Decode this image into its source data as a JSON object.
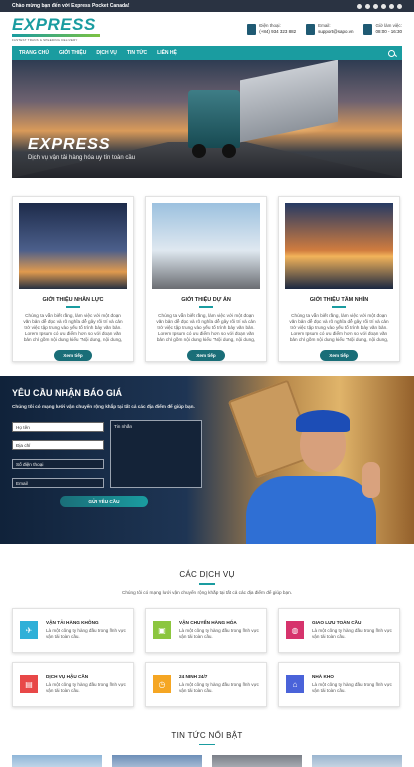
{
  "topbar": {
    "welcome": "Chào mừng bạn đến với Express Pocket Canada!"
  },
  "header": {
    "logo": "EXPRESS",
    "logo_tagline": "FASTEST TRANS & SPEEDING DELIVERY",
    "phone_label": "Điện thoại:",
    "phone_value": "(+84) 934 323 882",
    "email_label": "Email:",
    "email_value": "support@sapo.vn",
    "hours_label": "Giờ làm việc:",
    "hours_value": "08:00 - 16:30"
  },
  "nav": {
    "items": [
      {
        "label": "TRANG CHỦ"
      },
      {
        "label": "GIỚI THIỆU"
      },
      {
        "label": "DỊCH VỤ"
      },
      {
        "label": "TIN TỨC"
      },
      {
        "label": "LIÊN HỆ"
      }
    ]
  },
  "hero": {
    "title": "EXPRESS",
    "subtitle": "Dịch vụ vận tải hàng hóa uy tín toàn cầu"
  },
  "cards": [
    {
      "title": "GIỚI THIỆU NHÂN LỰC",
      "text": "Chúng ta vẫn biết rằng, làm việc với một đoạn văn bản dễ đọc và rõ nghĩa dễ gây rối trí và cản trở việc tập trung vào yếu tố trình bày văn bản. Lorem Ipsum có ưu điểm hơn so với đoạn văn bản chỉ gồm nội dung kiểu \"Nội dung, nội dung, nội dung\"",
      "button": "Xem tiếp"
    },
    {
      "title": "GIỚI THIỆU DỰ ÁN",
      "text": "Chúng ta vẫn biết rằng, làm việc với một đoạn văn bản dễ đọc và rõ nghĩa dễ gây rối trí và cản trở việc tập trung vào yếu tố trình bày văn bản. Lorem Ipsum có ưu điểm hơn so với đoạn văn bản chỉ gồm nội dung kiểu \"Nội dung, nội dung, nội dung\"",
      "button": "Xem tiếp"
    },
    {
      "title": "GIỚI THIỆU TẦM NHÌN",
      "text": "Chúng ta vẫn biết rằng, làm việc với một đoạn văn bản dễ đọc và rõ nghĩa dễ gây rối trí và cản trở việc tập trung vào yếu tố trình bày văn bản. Lorem Ipsum có ưu điểm hơn so với đoạn văn bản chỉ gồm nội dung kiểu \"Nội dung, nội dung, nội dung\"",
      "button": "Xem tiếp"
    }
  ],
  "quote": {
    "title": "YÊU CẦU NHẬN BÁO GIÁ",
    "subtitle": "Chúng tôi có mạng lưới vận chuyển rộng khắp tại tất cả các địa điểm để giúp bạn.",
    "name_placeholder": "Họ tên",
    "address_placeholder": "Địa chỉ",
    "phone_placeholder": "Số điện thoại",
    "email_placeholder": "Email",
    "message_placeholder": "Tin nhắn",
    "submit": "GỬI YÊU CẦU"
  },
  "services": {
    "title": "CÁC DỊCH VỤ",
    "subtitle": "Chúng tôi có mạng lưới vận chuyển rộng khắp tại tất cả các địa điểm để giúp bạn.",
    "items": [
      {
        "title": "VẬN TẢI HÀNG KHÔNG",
        "desc": "Là một công ty hàng đầu trong lĩnh vực vận tải toàn cầu.",
        "color": "#2fb0d8",
        "icon": "plane-icon"
      },
      {
        "title": "VẬN CHUYỂN HÀNG HÓA",
        "desc": "Là một công ty hàng đầu trong lĩnh vực vận tải toàn cầu.",
        "color": "#8cc63f",
        "icon": "package-icon"
      },
      {
        "title": "GIAO LƯU TOÀN CẦU",
        "desc": "Là một công ty hàng đầu trong lĩnh vực vận tải toàn cầu.",
        "color": "#d6336c",
        "icon": "globe-icon"
      },
      {
        "title": "DỊCH VỤ HẬU CẦN",
        "desc": "Là một công ty hàng đầu trong lĩnh vực vận tải toàn cầu.",
        "color": "#e84848",
        "icon": "truck-icon"
      },
      {
        "title": "24 NINH 24/7",
        "desc": "Là một công ty hàng đầu trong lĩnh vực vận tải toàn cầu.",
        "color": "#f5a623",
        "icon": "clock-icon"
      },
      {
        "title": "NHÀ KHO",
        "desc": "Là một công ty hàng đầu trong lĩnh vực vận tải toàn cầu.",
        "color": "#4a63d9",
        "icon": "warehouse-icon"
      }
    ]
  },
  "news": {
    "title": "TIN TỨC NỔI BẬT"
  }
}
